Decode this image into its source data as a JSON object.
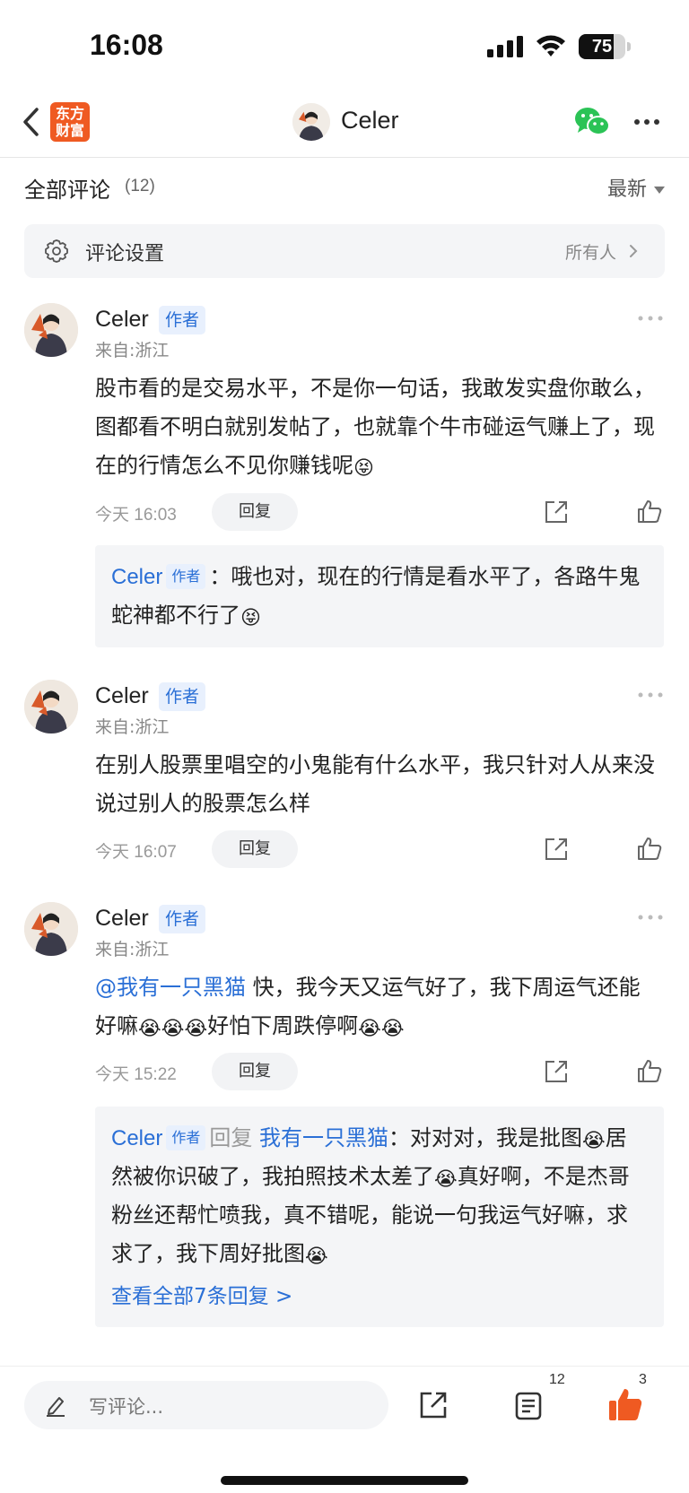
{
  "status_bar": {
    "time": "16:08",
    "battery": "75",
    "battery_level": 0.75
  },
  "nav": {
    "logo_line1": "东方",
    "logo_line2": "财富",
    "user_name": "Celer",
    "brand_color": "#ef5a22",
    "wechat_color": "#2bc356"
  },
  "comments_header": {
    "title": "全部评论",
    "count": "(12)",
    "sort": "最新"
  },
  "settings": {
    "label": "评论设置",
    "value": "所有人"
  },
  "comments": [
    {
      "name": "Celer",
      "badge": "作者",
      "location": "来自:浙江",
      "text": "股市看的是交易水平，不是你一句话，我敢发实盘你敢么，图都看不明白就别发帖了，也就靠个牛市碰运气赚上了，现在的行情怎么不见你赚钱呢",
      "emoji": "😝",
      "time": "今天 16:03",
      "reply": "回复",
      "sub_reply": {
        "name": "Celer",
        "badge": "作者",
        "colon": "：",
        "text": "哦也对，现在的行情是看水平了，各路牛鬼蛇神都不行了",
        "emoji": "😝"
      }
    },
    {
      "name": "Celer",
      "badge": "作者",
      "location": "来自:浙江",
      "text": "在别人股票里唱空的小鬼能有什么水平，我只针对人从来没说过别人的股票怎么样",
      "time": "今天 16:07",
      "reply": "回复"
    },
    {
      "name": "Celer",
      "badge": "作者",
      "location": "来自:浙江",
      "mention": "@我有一只黑猫",
      "text_a": " 快，我今天又运气好了，我下周运气还能好嘛",
      "emoji": "😭",
      "text_b": "好怕下周跌停啊",
      "time": "今天 15:22",
      "reply": "回复",
      "sub_reply": {
        "name": "Celer",
        "badge": "作者",
        "reply_word": "回复",
        "target": "我有一只黑猫",
        "colon": "：",
        "text_a": "对对对，我是批图",
        "text_b": "居然被你识破了，我拍照技术太差了",
        "text_c": "真好啊，不是杰哥粉丝还帮忙喷我，真不错呢，能说一句我运气好嘛，求求了，我下周好批图",
        "emoji": "😭",
        "view_all": "查看全部7条回复 >"
      }
    }
  ],
  "bottom_bar": {
    "placeholder": "写评论...",
    "list_count": "12",
    "like_count": "3"
  }
}
